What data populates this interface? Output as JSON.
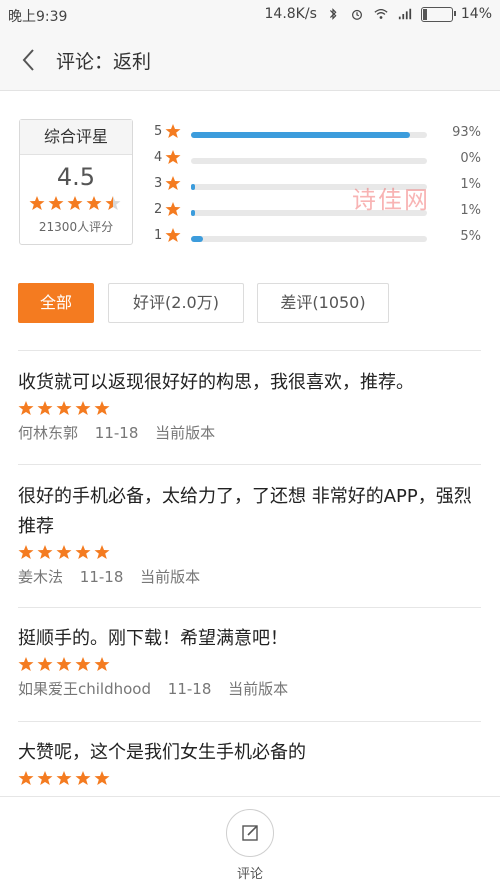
{
  "status_bar": {
    "time": "晚上9:39",
    "speed": "14.8K/s",
    "battery_percent": "14%",
    "battery_level": 0.14
  },
  "header": {
    "title": "评论：返利"
  },
  "summary": {
    "label": "综合评星",
    "score": "4.5",
    "score_value": 4.5,
    "count": "21300人评分",
    "distribution": [
      {
        "level": "5",
        "percent_text": "93%",
        "percent": 93
      },
      {
        "level": "4",
        "percent_text": "0%",
        "percent": 0
      },
      {
        "level": "3",
        "percent_text": "1%",
        "percent": 1
      },
      {
        "level": "2",
        "percent_text": "1%",
        "percent": 1
      },
      {
        "level": "1",
        "percent_text": "5%",
        "percent": 5
      }
    ]
  },
  "watermark": "诗佳网",
  "filters": [
    {
      "label": "全部",
      "active": true
    },
    {
      "label": "好评(2.0万)",
      "active": false
    },
    {
      "label": "差评(1050)",
      "active": false
    }
  ],
  "reviews": [
    {
      "text": "收货就可以返现很好好的构思，我很喜欢，推荐。",
      "rating": 5,
      "author": "何林东郭",
      "date": "11-18",
      "version": "当前版本"
    },
    {
      "text": "很好的手机必备，太给力了，了还想 非常好的APP，强烈推荐",
      "rating": 5,
      "author": "姜木法",
      "date": "11-18",
      "version": "当前版本"
    },
    {
      "text": "挺顺手的。刚下载！希望满意吧！",
      "rating": 5,
      "author": "如果爱王childhood",
      "date": "11-18",
      "version": "当前版本"
    },
    {
      "text": "大赞呢，这个是我们女生手机必备的",
      "rating": 5,
      "author": "",
      "date": "",
      "version": ""
    }
  ],
  "bottom": {
    "comment_label": "评论"
  },
  "colors": {
    "accent": "#f47b20",
    "bar": "#3c9cdc",
    "star": "#f47b20"
  }
}
